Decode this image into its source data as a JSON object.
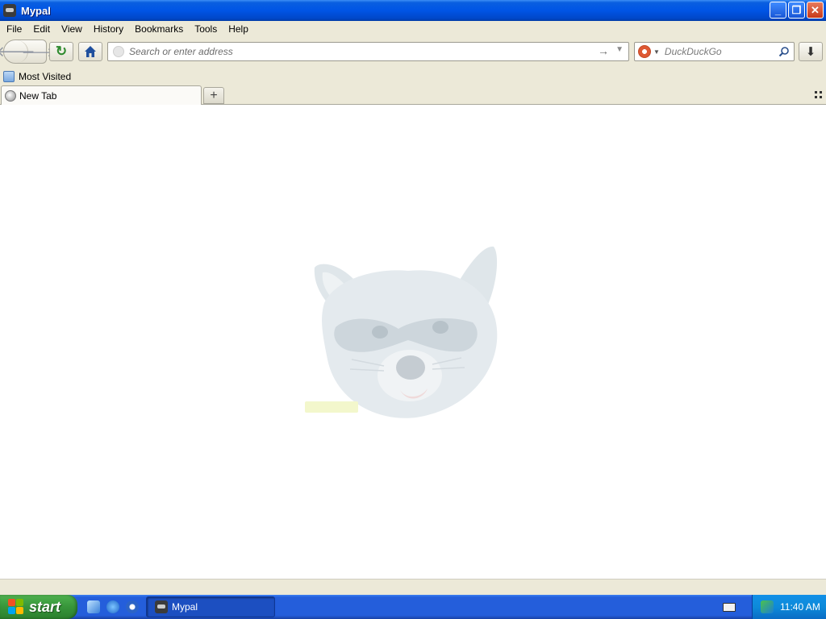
{
  "window": {
    "title": "Mypal"
  },
  "window_controls": {
    "minimize": "_",
    "restore": "❐",
    "close": "✕"
  },
  "menu": [
    "File",
    "Edit",
    "View",
    "History",
    "Bookmarks",
    "Tools",
    "Help"
  ],
  "address_bar": {
    "placeholder": "Search or enter address",
    "value": ""
  },
  "search_bar": {
    "placeholder": "DuckDuckGo",
    "engine": "DuckDuckGo"
  },
  "bookmarks": {
    "most_visited": "Most Visited"
  },
  "tabs": [
    {
      "label": "New Tab"
    }
  ],
  "newtab": {
    "plus": "+"
  },
  "content": {
    "logo": "raccoon-logo"
  },
  "taskbar": {
    "start_label": "start",
    "task_label": "Mypal",
    "clock": "11:40 AM"
  },
  "colors": {
    "titlebar": "#0055e5",
    "chrome": "#ece9d8",
    "taskbar": "#245edb",
    "start": "#37953a"
  }
}
